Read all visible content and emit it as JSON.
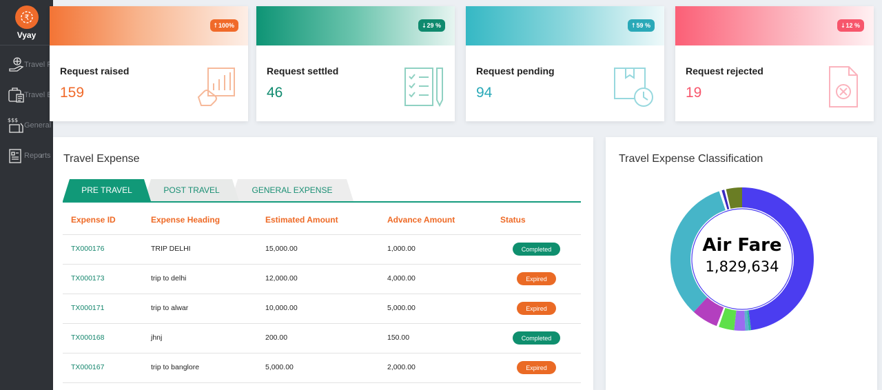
{
  "app": {
    "name": "Vyay"
  },
  "sidebar": {
    "items": [
      {
        "label": "Travel Re",
        "icon": "travel-request-icon",
        "chevron": ""
      },
      {
        "label": "Travel Ex",
        "icon": "travel-expense-icon",
        "chevron": ""
      },
      {
        "label": "General",
        "icon": "general-expense-icon",
        "chevron": ""
      },
      {
        "label": "Reports",
        "icon": "reports-icon",
        "chevron": "‹"
      }
    ]
  },
  "cards": [
    {
      "title": "Request raised",
      "value": "159",
      "badge": "100%",
      "badge_arrow": "up",
      "color": "#f06a2a",
      "icon": "hand-chart-icon"
    },
    {
      "title": "Request settled",
      "value": "46",
      "badge": "29 %",
      "badge_arrow": "down",
      "color": "#0f8a6e",
      "icon": "checklist-pencil-icon"
    },
    {
      "title": "Request pending",
      "value": "94",
      "badge": "59 %",
      "badge_arrow": "up",
      "color": "#2aa9b8",
      "icon": "box-clock-icon"
    },
    {
      "title": "Request rejected",
      "value": "19",
      "badge": "12 %",
      "badge_arrow": "down",
      "color": "#f7566c",
      "icon": "document-x-icon"
    }
  ],
  "travel_expense": {
    "title": "Travel Expense",
    "tabs": [
      {
        "label": "PRE TRAVEL",
        "active": true
      },
      {
        "label": "POST TRAVEL",
        "active": false
      },
      {
        "label": "GENERAL EXPENSE",
        "active": false
      }
    ],
    "columns": [
      "Expense ID",
      "Expense Heading",
      "Estimated Amount",
      "Advance Amount",
      "Status"
    ],
    "rows": [
      {
        "id": "TX000176",
        "heading": "TRIP DELHI",
        "estimated": "15,000.00",
        "advance": "1,000.00",
        "status": "Completed"
      },
      {
        "id": "TX000173",
        "heading": "trip to delhi",
        "estimated": "12,000.00",
        "advance": "4,000.00",
        "status": "Expired"
      },
      {
        "id": "TX000171",
        "heading": "trip to alwar",
        "estimated": "10,000.00",
        "advance": "5,000.00",
        "status": "Expired"
      },
      {
        "id": "TX000168",
        "heading": "jhnj",
        "estimated": "200.00",
        "advance": "150.00",
        "status": "Completed"
      },
      {
        "id": "TX000167",
        "heading": "trip to banglore",
        "estimated": "5,000.00",
        "advance": "2,000.00",
        "status": "Expired"
      }
    ]
  },
  "classification": {
    "title": "Travel Expense Classification",
    "center_label": "Air Fare",
    "center_value": "1,829,634"
  },
  "chart_data": {
    "type": "pie",
    "title": "Travel Expense Classification",
    "slices": [
      {
        "name": "Air Fare",
        "value": 1829634,
        "color": "#4b3df0",
        "share": 0.48
      },
      {
        "name": "",
        "value": null,
        "color": "#2fb5a1",
        "share": 0.005
      },
      {
        "name": "",
        "value": null,
        "color": "#5fb0d0",
        "share": 0.008
      },
      {
        "name": "",
        "value": null,
        "color": "#9b6cf0",
        "share": 0.025
      },
      {
        "name": "",
        "value": null,
        "color": "#5ee04a",
        "share": 0.035
      },
      {
        "name": "",
        "value": null,
        "color": "#ffffff",
        "share": 0.005
      },
      {
        "name": "",
        "value": null,
        "color": "#b33fbf",
        "share": 0.06
      },
      {
        "name": "",
        "value": null,
        "color": "#46b5c8",
        "share": 0.33
      },
      {
        "name": "",
        "value": null,
        "color": "#ffffff",
        "share": 0.006
      },
      {
        "name": "",
        "value": null,
        "color": "#3b2bbf",
        "share": 0.006
      },
      {
        "name": "",
        "value": null,
        "color": "#ffffff",
        "share": 0.004
      },
      {
        "name": "",
        "value": null,
        "color": "#6a7d24",
        "share": 0.036
      }
    ]
  }
}
